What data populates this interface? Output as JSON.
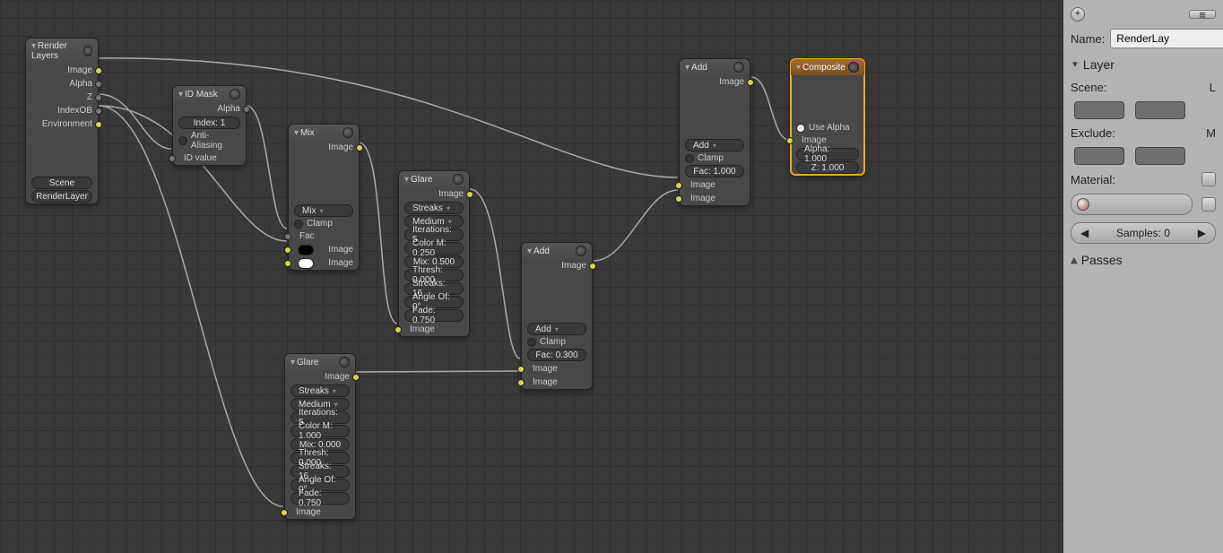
{
  "nodes": {
    "renderLayers": {
      "title": "Render Layers",
      "outputs": [
        "Image",
        "Alpha",
        "Z",
        "IndexOB",
        "Environment"
      ],
      "scene": "Scene",
      "layer": "RenderLayer"
    },
    "idMask": {
      "title": "ID Mask",
      "outAlpha": "Alpha",
      "index": "Index: 1",
      "antiAliasing": "Anti-Aliasing",
      "idValueIn": "ID value"
    },
    "mix": {
      "title": "Mix",
      "outImage": "Image",
      "mode": "Mix",
      "clamp": "Clamp",
      "fac": "Fac",
      "imageIn": "Image"
    },
    "glare1": {
      "title": "Glare",
      "outImage": "Image",
      "type": "Streaks",
      "quality": "Medium",
      "iterations": "Iterations: 5",
      "colorM": "Color M: 0.250",
      "mixAmt": "Mix: 0.500",
      "thresh": "Thresh: 0.000",
      "streaks": "Streaks: 16",
      "angleOf": "Angle Of: 0°",
      "fade": "Fade: 0.750",
      "imageIn": "Image"
    },
    "glare2": {
      "title": "Glare",
      "outImage": "Image",
      "type": "Streaks",
      "quality": "Medium",
      "iterations": "Iterations: 5",
      "colorM": "Color M: 1.000",
      "mixAmt": "Mix: 0.000",
      "thresh": "Thresh: 0.000",
      "streaks": "Streaks: 16",
      "angleOf": "Angle Of: 0°",
      "fade": "Fade: 0.750",
      "imageIn": "Image"
    },
    "add1": {
      "title": "Add",
      "outImage": "Image",
      "mode": "Add",
      "clamp": "Clamp",
      "fac": "Fac: 0.300",
      "imageIn": "Image"
    },
    "add2": {
      "title": "Add",
      "outImage": "Image",
      "mode": "Add",
      "clamp": "Clamp",
      "fac": "Fac: 1.000",
      "imageIn": "Image"
    },
    "composite": {
      "title": "Composite",
      "useAlpha": "Use Alpha",
      "imageIn": "Image",
      "alpha": "Alpha: 1.000",
      "z": "Z: 1.000"
    }
  },
  "panel": {
    "name_label": "Name:",
    "name_value": "RenderLay",
    "layer_header": "Layer",
    "scene_label": "Scene:",
    "exclude_label": "Exclude:",
    "material_label": "Material:",
    "samples": "Samples: 0",
    "passes_header": "Passes"
  }
}
